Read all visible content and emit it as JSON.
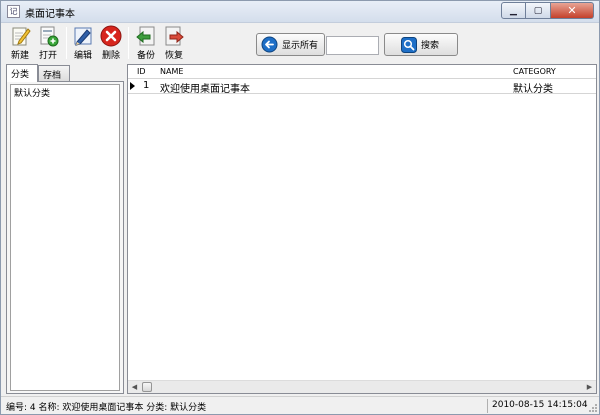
{
  "window": {
    "app_icon": "记",
    "title": "桌面记事本",
    "controls": {
      "minimize": "▁",
      "maximize": "▢",
      "close": "✕"
    }
  },
  "toolbar": {
    "new_label": "新建",
    "open_label": "打开",
    "edit_label": "编辑",
    "delete_label": "删除",
    "backup_label": "备份",
    "restore_label": "恢复",
    "show_all_label": "显示所有",
    "search_value": "",
    "search_label": "搜索"
  },
  "left_panel": {
    "tabs": [
      {
        "label": "分类",
        "active": true
      },
      {
        "label": "存档",
        "active": false
      }
    ],
    "categories": [
      "默认分类"
    ]
  },
  "grid": {
    "columns": {
      "id": "ID",
      "name": "NAME",
      "category": "CATEGORY"
    },
    "rows": [
      {
        "id": "1",
        "name": "欢迎使用桌面记事本",
        "category": "默认分类",
        "current": true
      }
    ]
  },
  "status": {
    "info": "编号: 4  名称: 欢迎使用桌面记事本  分类: 默认分类",
    "datetime": "2010-08-15 14:15:04"
  },
  "colors": {
    "accent_blue": "#1e6fc7",
    "delete_red": "#d7261e",
    "titlebar": "#dbe4f1"
  }
}
